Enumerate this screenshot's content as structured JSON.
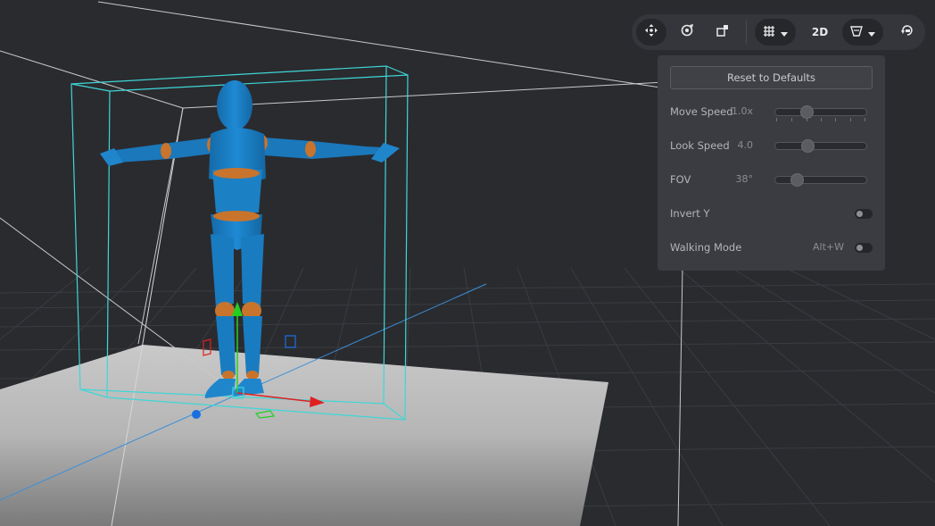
{
  "toolbar": {
    "items": [
      {
        "id": "move",
        "icon": "move-arrows-icon"
      },
      {
        "id": "rotate",
        "icon": "orbit-icon"
      },
      {
        "id": "scale",
        "icon": "scale-icon"
      },
      {
        "id": "grid",
        "icon": "grid-icon",
        "has_dropdown": true
      },
      {
        "id": "view2d",
        "label": "2D"
      },
      {
        "id": "shading",
        "icon": "shading-icon",
        "has_dropdown": true
      },
      {
        "id": "camera-reset",
        "icon": "camera-reset-icon"
      }
    ],
    "view2d_label": "2D"
  },
  "settings": {
    "reset_label": "Reset to Defaults",
    "move_speed": {
      "label": "Move Speed",
      "value": "1.0x",
      "fraction": 0.35
    },
    "look_speed": {
      "label": "Look Speed",
      "value": "4.0",
      "fraction": 0.36
    },
    "fov": {
      "label": "FOV",
      "value": "38°",
      "fraction": 0.24
    },
    "invert_y": {
      "label": "Invert Y",
      "enabled": false
    },
    "walking_mode": {
      "label": "Walking Mode",
      "shortcut": "Alt+W",
      "enabled": false
    }
  },
  "colors": {
    "background": "#2a2b2f",
    "grid_line": "#3c3e43",
    "selection_box": "#3fd6d6",
    "mannequin": "#1f86cc",
    "mannequin_joint": "#c8742c",
    "gizmo_x": "#e02020",
    "gizmo_y": "#22d022",
    "gizmo_z": "#1a6fe0",
    "panel_bg": "#3b3c41"
  }
}
